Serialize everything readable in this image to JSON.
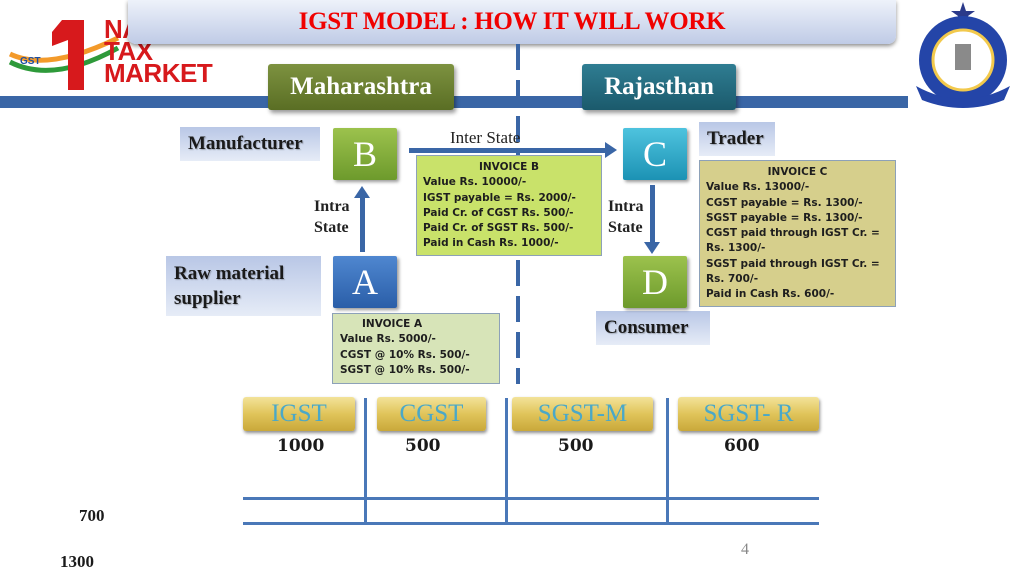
{
  "header": {
    "title": "IGST MODEL : HOW IT WILL WORK",
    "logo": {
      "line1": "NA",
      "line2": "TAX",
      "line3": "MARKET",
      "badge": "GST",
      "numeral": "1"
    },
    "emblem": "customs-central-excise-emblem"
  },
  "states": {
    "left": "Maharashtra",
    "right": "Rajasthan"
  },
  "roles": {
    "manufacturer": "Manufacturer",
    "raw_material_supplier": [
      "Raw material",
      "supplier"
    ],
    "trader": "Trader",
    "consumer": "Consumer"
  },
  "nodes": {
    "a": "A",
    "b": "B",
    "c": "C",
    "d": "D"
  },
  "flows": {
    "inter_state": "Inter State",
    "intra_state": [
      "Intra",
      "State"
    ]
  },
  "invoices": {
    "a": {
      "title": "INVOICE A",
      "lines": [
        "Value Rs. 5000/-",
        "CGST @ 10%  Rs. 500/-",
        "SGST @ 10%  Rs. 500/-"
      ]
    },
    "b": {
      "title": "INVOICE B",
      "lines": [
        "Value Rs. 10000/-",
        "IGST payable = Rs. 2000/-",
        "Paid Cr. of CGST Rs. 500/-",
        "Paid Cr. of SGST Rs. 500/-",
        "Paid in Cash Rs. 1000/-"
      ]
    },
    "c": {
      "title": "INVOICE C",
      "lines": [
        "Value Rs. 13000/-",
        "CGST payable = Rs. 1300/-",
        "SGST payable = Rs. 1300/-",
        "CGST paid through IGST Cr. =",
        "Rs. 1300/-",
        "SGST paid through IGST  Cr. =",
        "Rs. 700/-",
        "Paid in Cash Rs. 600/-"
      ]
    }
  },
  "accounts": [
    {
      "name": "IGST",
      "amount": "1000"
    },
    {
      "name": "CGST",
      "amount": "500"
    },
    {
      "name": "SGST-M",
      "amount": "500"
    },
    {
      "name": "SGST- R",
      "amount": "600"
    }
  ],
  "side_numbers": [
    "700",
    "1300"
  ],
  "page_number": "4",
  "colors": {
    "title_red": "#f00000",
    "band_blue": "#3a66a6",
    "maharashtra_green": "#6b8030",
    "rajasthan_teal": "#236a7e",
    "invoice_b": "#c9e26a",
    "invoice_c": "#d6cf8c",
    "invoice_a": "#d7e4b8",
    "account_gold": "#e0c45a",
    "account_text": "#4aa8c8"
  }
}
